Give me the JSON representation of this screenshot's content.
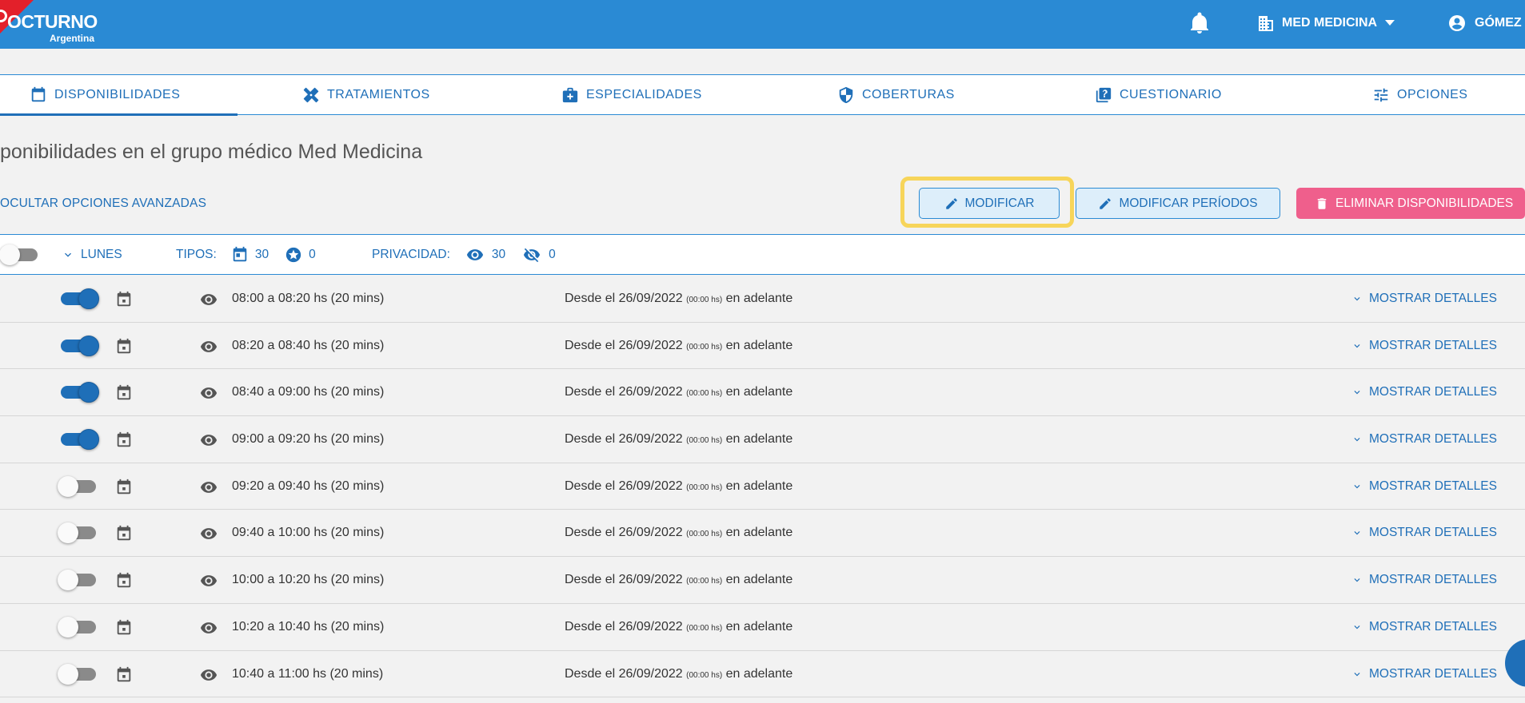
{
  "brand": {
    "name": "OCTURNO",
    "country": "Argentina",
    "accent": "#2a8ad4",
    "corner": "#e3202a"
  },
  "header": {
    "org_label": "MED MEDICINA",
    "user_label": "GÓMEZ"
  },
  "tabs": [
    {
      "label": "DISPONIBILIDADES",
      "icon": "calendar-icon",
      "active": true
    },
    {
      "label": "TRATAMIENTOS",
      "icon": "bandage-icon",
      "active": false
    },
    {
      "label": "ESPECIALIDADES",
      "icon": "medical-bag-icon",
      "active": false
    },
    {
      "label": "COBERTURAS",
      "icon": "shield-icon",
      "active": false
    },
    {
      "label": "CUESTIONARIO",
      "icon": "question-book-icon",
      "active": false
    },
    {
      "label": "OPCIONES",
      "icon": "tune-icon",
      "active": false
    }
  ],
  "page": {
    "title": "ponibilidades en el grupo médico Med Medicina"
  },
  "actions": {
    "advanced_link": "OCULTAR OPCIONES AVANZADAS",
    "modify": "MODIFICAR",
    "modify_periods": "MODIFICAR PERÍODOS",
    "delete": "ELIMINAR DISPONIBILIDADES",
    "danger_color": "#ef5f8c"
  },
  "day_filter": {
    "day": "LUNES",
    "types_label": "TIPOS:",
    "types_calendar_count": "30",
    "types_star_count": "0",
    "privacy_label": "PRIVACIDAD:",
    "visible_count": "30",
    "hidden_count": "0",
    "toggle_on": false
  },
  "rows": [
    {
      "enabled": true,
      "time": "08:00 a 08:20 hs (20 mins)",
      "since_prefix": "Desde el 26/09/2022",
      "since_hour": "(00:00 hs)",
      "since_suffix": "en adelante",
      "details": "MOSTRAR DETALLES"
    },
    {
      "enabled": true,
      "time": "08:20 a 08:40 hs (20 mins)",
      "since_prefix": "Desde el 26/09/2022",
      "since_hour": "(00:00 hs)",
      "since_suffix": "en adelante",
      "details": "MOSTRAR DETALLES"
    },
    {
      "enabled": true,
      "time": "08:40 a 09:00 hs (20 mins)",
      "since_prefix": "Desde el 26/09/2022",
      "since_hour": "(00:00 hs)",
      "since_suffix": "en adelante",
      "details": "MOSTRAR DETALLES"
    },
    {
      "enabled": true,
      "time": "09:00 a 09:20 hs (20 mins)",
      "since_prefix": "Desde el 26/09/2022",
      "since_hour": "(00:00 hs)",
      "since_suffix": "en adelante",
      "details": "MOSTRAR DETALLES"
    },
    {
      "enabled": false,
      "time": "09:20 a 09:40 hs (20 mins)",
      "since_prefix": "Desde el 26/09/2022",
      "since_hour": "(00:00 hs)",
      "since_suffix": "en adelante",
      "details": "MOSTRAR DETALLES"
    },
    {
      "enabled": false,
      "time": "09:40 a 10:00 hs (20 mins)",
      "since_prefix": "Desde el 26/09/2022",
      "since_hour": "(00:00 hs)",
      "since_suffix": "en adelante",
      "details": "MOSTRAR DETALLES"
    },
    {
      "enabled": false,
      "time": "10:00 a 10:20 hs (20 mins)",
      "since_prefix": "Desde el 26/09/2022",
      "since_hour": "(00:00 hs)",
      "since_suffix": "en adelante",
      "details": "MOSTRAR DETALLES"
    },
    {
      "enabled": false,
      "time": "10:20 a 10:40 hs (20 mins)",
      "since_prefix": "Desde el 26/09/2022",
      "since_hour": "(00:00 hs)",
      "since_suffix": "en adelante",
      "details": "MOSTRAR DETALLES"
    },
    {
      "enabled": false,
      "time": "10:40 a 11:00 hs (20 mins)",
      "since_prefix": "Desde el 26/09/2022",
      "since_hour": "(00:00 hs)",
      "since_suffix": "en adelante",
      "details": "MOSTRAR DETALLES"
    }
  ]
}
